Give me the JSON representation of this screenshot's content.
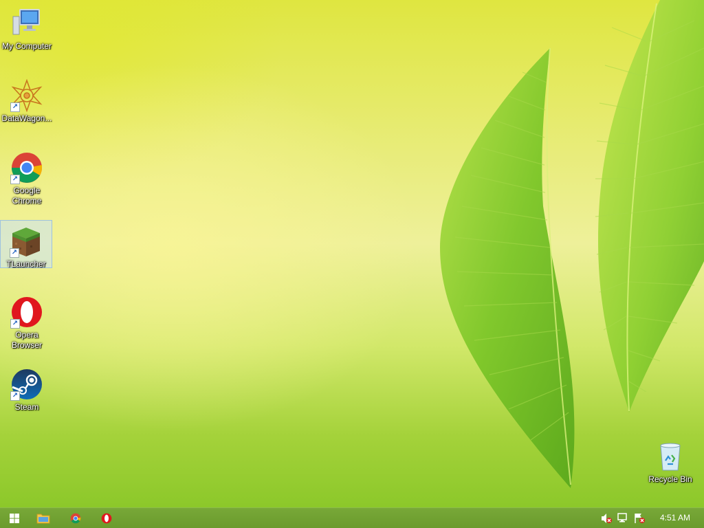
{
  "desktop": {
    "icons": [
      {
        "id": "my-computer",
        "label": "My Computer"
      },
      {
        "id": "datawagon",
        "label": "DataWagon..."
      },
      {
        "id": "google-chrome",
        "label": "Google Chrome"
      },
      {
        "id": "tlauncher",
        "label": "TLauncher",
        "selected": true
      },
      {
        "id": "opera-browser",
        "label": "Opera Browser"
      },
      {
        "id": "steam",
        "label": "Steam"
      },
      {
        "id": "recycle-bin",
        "label": "Recycle Bin"
      }
    ]
  },
  "taskbar": {
    "buttons": [
      {
        "name": "start-button",
        "icon": "windows-logo-icon"
      },
      {
        "name": "file-explorer-button",
        "icon": "folder-icon"
      },
      {
        "name": "chrome-taskbar-button",
        "icon": "chrome-icon"
      },
      {
        "name": "opera-taskbar-button",
        "icon": "opera-icon"
      }
    ],
    "tray": [
      {
        "name": "volume-muted-icon"
      },
      {
        "name": "network-disconnected-icon"
      },
      {
        "name": "action-center-icon"
      }
    ],
    "clock": "4:51 AM"
  },
  "colors": {
    "taskbar": "#6f9f30",
    "selection": "#cfe3f5",
    "chrome_red": "#db4437",
    "chrome_green": "#0f9d58",
    "chrome_yellow": "#f4b400",
    "chrome_blue": "#4285f4",
    "opera_red": "#e0171e",
    "steam_blue": "#1b2838"
  }
}
